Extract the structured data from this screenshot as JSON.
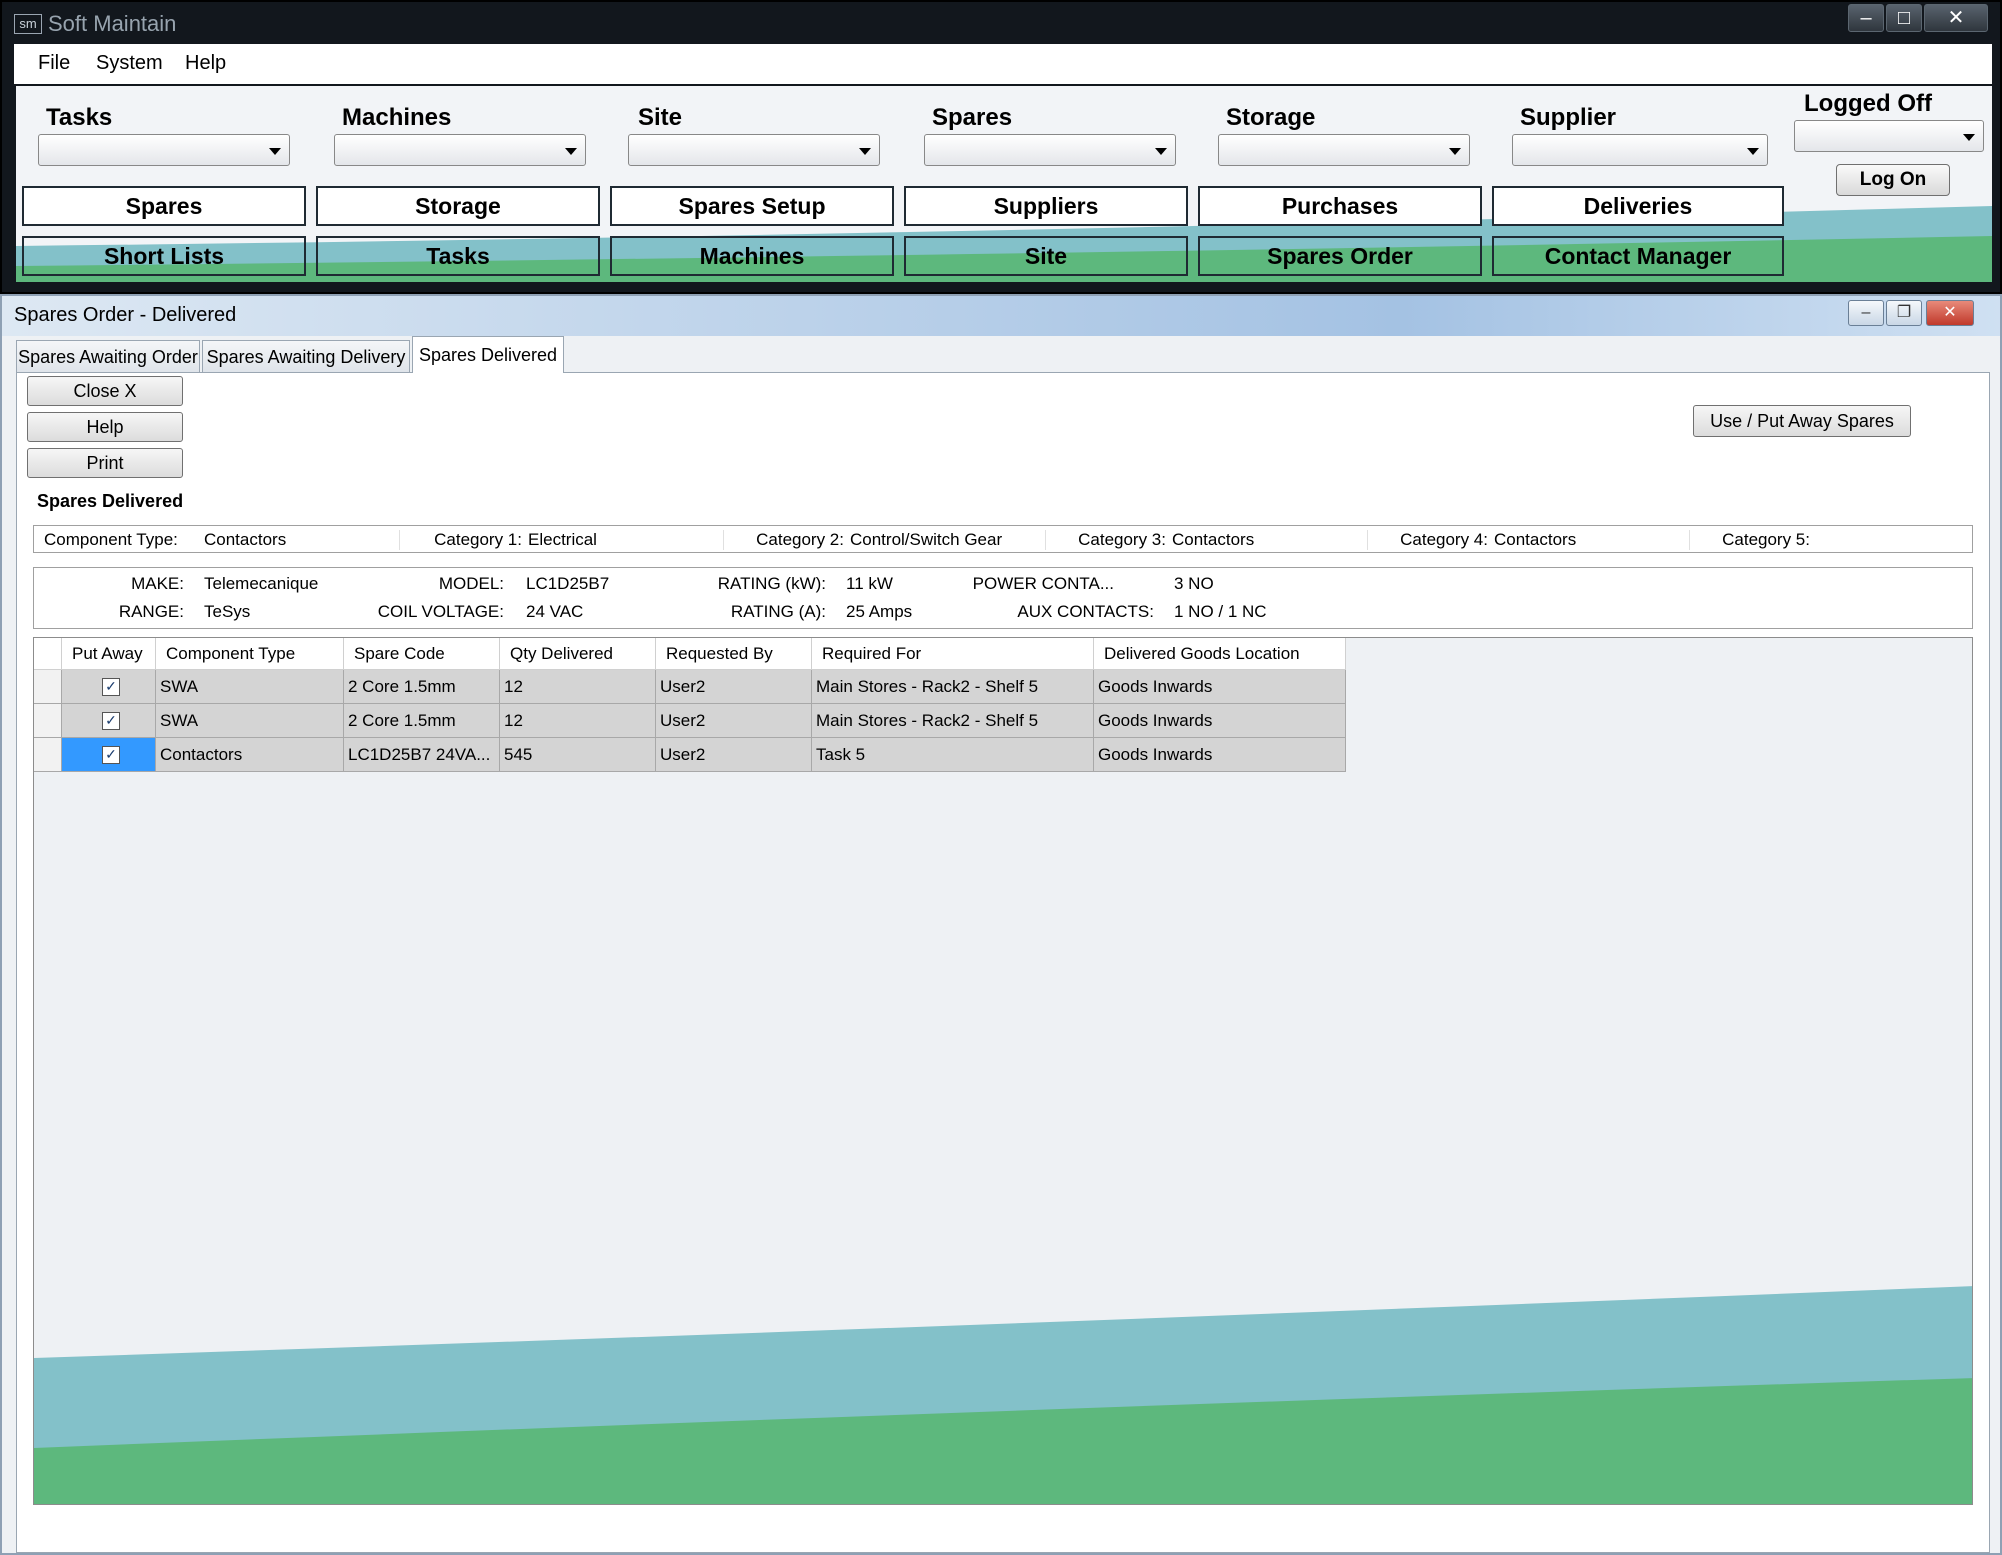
{
  "app": {
    "title": "Soft Maintain",
    "logo_text": "sm",
    "menu": [
      "File",
      "System",
      "Help"
    ]
  },
  "toolbar": {
    "combos": [
      {
        "label": "Tasks"
      },
      {
        "label": "Machines"
      },
      {
        "label": "Site"
      },
      {
        "label": "Spares"
      },
      {
        "label": "Storage"
      },
      {
        "label": "Supplier"
      }
    ],
    "login_status": "Logged Off",
    "logon_button": "Log On",
    "nav_row1": [
      "Spares",
      "Storage",
      "Spares Setup",
      "Suppliers",
      "Purchases",
      "Deliveries"
    ],
    "nav_row2": [
      "Short Lists",
      "Tasks",
      "Machines",
      "Site",
      "Spares Order",
      "Contact Manager"
    ]
  },
  "child": {
    "title": "Spares Order - Delivered",
    "tabs": [
      "Spares Awaiting Order",
      "Spares Awaiting Delivery",
      "Spares Delivered"
    ],
    "active_tab": "Spares Delivered",
    "buttons": {
      "close": "Close X",
      "help": "Help",
      "print": "Print",
      "put_away": "Use / Put Away Spares"
    },
    "section_title": "Spares Delivered",
    "categories": [
      {
        "label": "Component Type:",
        "value": "Contactors"
      },
      {
        "label": "Category 1:",
        "value": "Electrical"
      },
      {
        "label": "Category 2:",
        "value": "Control/Switch Gear"
      },
      {
        "label": "Category 3:",
        "value": "Contactors"
      },
      {
        "label": "Category 4:",
        "value": "Contactors"
      },
      {
        "label": "Category 5:",
        "value": ""
      }
    ],
    "specs": {
      "make_label": "MAKE:",
      "make": "Telemecanique",
      "range_label": "RANGE:",
      "range": "TeSys",
      "model_label": "MODEL:",
      "model": "LC1D25B7",
      "coil_label": "COIL VOLTAGE:",
      "coil": "24 VAC",
      "kw_label": "RATING (kW):",
      "kw": "11 kW",
      "amps_label": "RATING (A):",
      "amps": "25 Amps",
      "power_label": "POWER CONTA...",
      "power": "3 NO",
      "aux_label": "AUX CONTACTS:",
      "aux": "1 NO / 1 NC"
    },
    "grid": {
      "columns": [
        "Put Away",
        "Component Type",
        "Spare Code",
        "Qty Delivered",
        "Requested By",
        "Required For",
        "Delivered Goods Location"
      ],
      "rows": [
        {
          "put_away": "✓",
          "component_type": "SWA",
          "spare_code": "2 Core 1.5mm",
          "qty": "12",
          "requested_by": "User2",
          "required_for": "Main Stores - Rack2 - Shelf 5",
          "location": "Goods Inwards"
        },
        {
          "put_away": "✓",
          "component_type": "SWA",
          "spare_code": "2 Core 1.5mm",
          "qty": "12",
          "requested_by": "User2",
          "required_for": "Main Stores - Rack2 - Shelf 5",
          "location": "Goods Inwards"
        },
        {
          "put_away": "✓",
          "component_type": "Contactors",
          "spare_code": "LC1D25B7 24VA...",
          "qty": "545",
          "requested_by": "User2",
          "required_for": "Task 5",
          "location": "Goods Inwards"
        }
      ]
    }
  },
  "colors": {
    "wave_blue": "#83c1c9",
    "wave_green": "#5db87d",
    "selection": "#3399ff"
  }
}
